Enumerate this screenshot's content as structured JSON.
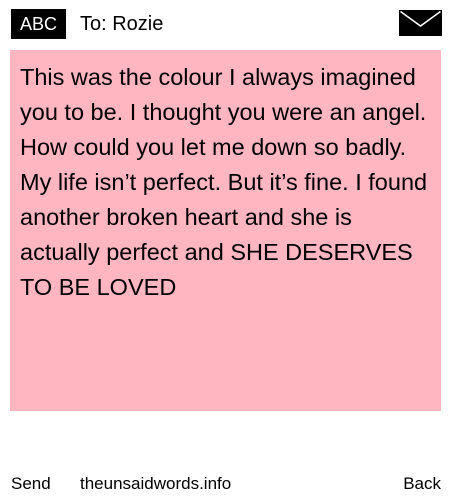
{
  "header": {
    "input_mode_label": "ABC",
    "recipient_label": "To: Rozie",
    "envelope_icon": "envelope-icon"
  },
  "message": {
    "text": "This was the colour I always imagined you to be. I thought you were an angel. How could you let me down so badly. My life isn’t perfect. But it’s fine. I found another broken heart and she is actually perfect and SHE DESERVES TO BE LOVED",
    "background_color": "#ffb6c1"
  },
  "footer": {
    "send_label": "Send",
    "site_label": "theunsaidwords.info",
    "back_label": "Back"
  }
}
